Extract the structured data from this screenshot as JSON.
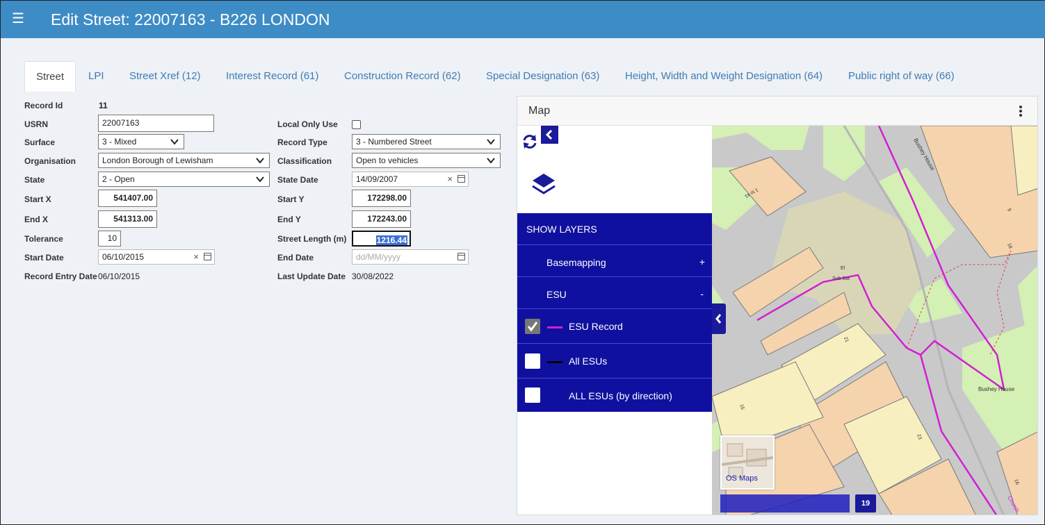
{
  "header": {
    "menu_icon": "hamburger-menu-icon",
    "title": "Edit Street: 22007163 - B226 LONDON"
  },
  "tabs": [
    {
      "label": "Street",
      "active": true
    },
    {
      "label": "LPI"
    },
    {
      "label": "Street Xref (12)"
    },
    {
      "label": "Interest Record (61)"
    },
    {
      "label": "Construction Record (62)"
    },
    {
      "label": "Special Designation (63)"
    },
    {
      "label": "Height, Width and Weight Designation (64)"
    },
    {
      "label": "Public right of way (66)"
    }
  ],
  "form": {
    "record_id": {
      "label": "Record Id",
      "value": "11"
    },
    "usrn": {
      "label": "USRN",
      "value": "22007163"
    },
    "surface": {
      "label": "Surface",
      "value": "3 - Mixed"
    },
    "organisation": {
      "label": "Organisation",
      "value": "London Borough of Lewisham"
    },
    "state": {
      "label": "State",
      "value": "2 - Open"
    },
    "start_x": {
      "label": "Start X",
      "value": "541407.00"
    },
    "end_x": {
      "label": "End X",
      "value": "541313.00"
    },
    "tolerance": {
      "label": "Tolerance",
      "value": "10"
    },
    "start_date": {
      "label": "Start Date",
      "value": "06/10/2015"
    },
    "record_entry_date": {
      "label": "Record Entry Date",
      "value": "06/10/2015"
    },
    "local_only_use": {
      "label": "Local Only Use",
      "checked": false
    },
    "record_type": {
      "label": "Record Type",
      "value": "3 - Numbered Street"
    },
    "classification": {
      "label": "Classification",
      "value": "Open to vehicles"
    },
    "state_date": {
      "label": "State Date",
      "value": "14/09/2007"
    },
    "start_y": {
      "label": "Start Y",
      "value": "172298.00"
    },
    "end_y": {
      "label": "End Y",
      "value": "172243.00"
    },
    "street_length": {
      "label": "Street Length (m)",
      "value": "1216.44"
    },
    "end_date": {
      "label": "End Date",
      "placeholder": "dd/MM/yyyy"
    },
    "last_update_date": {
      "label": "Last Update Date",
      "value": "30/08/2022"
    }
  },
  "map": {
    "title": "Map",
    "layers": {
      "show_layers": "SHOW LAYERS",
      "basemapping": {
        "label": "Basemapping",
        "toggle": "+"
      },
      "esu": {
        "label": "ESU",
        "toggle": "-"
      },
      "items": [
        {
          "label": "ESU Record",
          "checked": true,
          "swatch": "#d21fd2"
        },
        {
          "label": "All ESUs",
          "checked": false,
          "swatch": "#000000"
        },
        {
          "label": "ALL ESUs (by direction)",
          "checked": false
        }
      ]
    },
    "basemap_thumb_label": "OS Maps",
    "zoom_level": "19",
    "labels": {
      "bushey_house_street": "Bushey House",
      "bushey_house_road": "Bushey House",
      "sub_sta": "Sub Sta",
      "el": "El",
      "num_1_to_41": "1 to 41",
      "num_21": "21",
      "num_23": "23",
      "num_15": "15",
      "num_16": "16",
      "num_18": "18",
      "num_9": "9",
      "road_edge": "Church"
    }
  },
  "colors": {
    "header": "#3e8cc6",
    "tab_link": "#3e7cb6",
    "layer_panel": "#1010a0",
    "esu_line": "#d21fd2",
    "building": "#f5d3ad",
    "green": "#d4f0b4",
    "road": "#c8c8c8"
  }
}
